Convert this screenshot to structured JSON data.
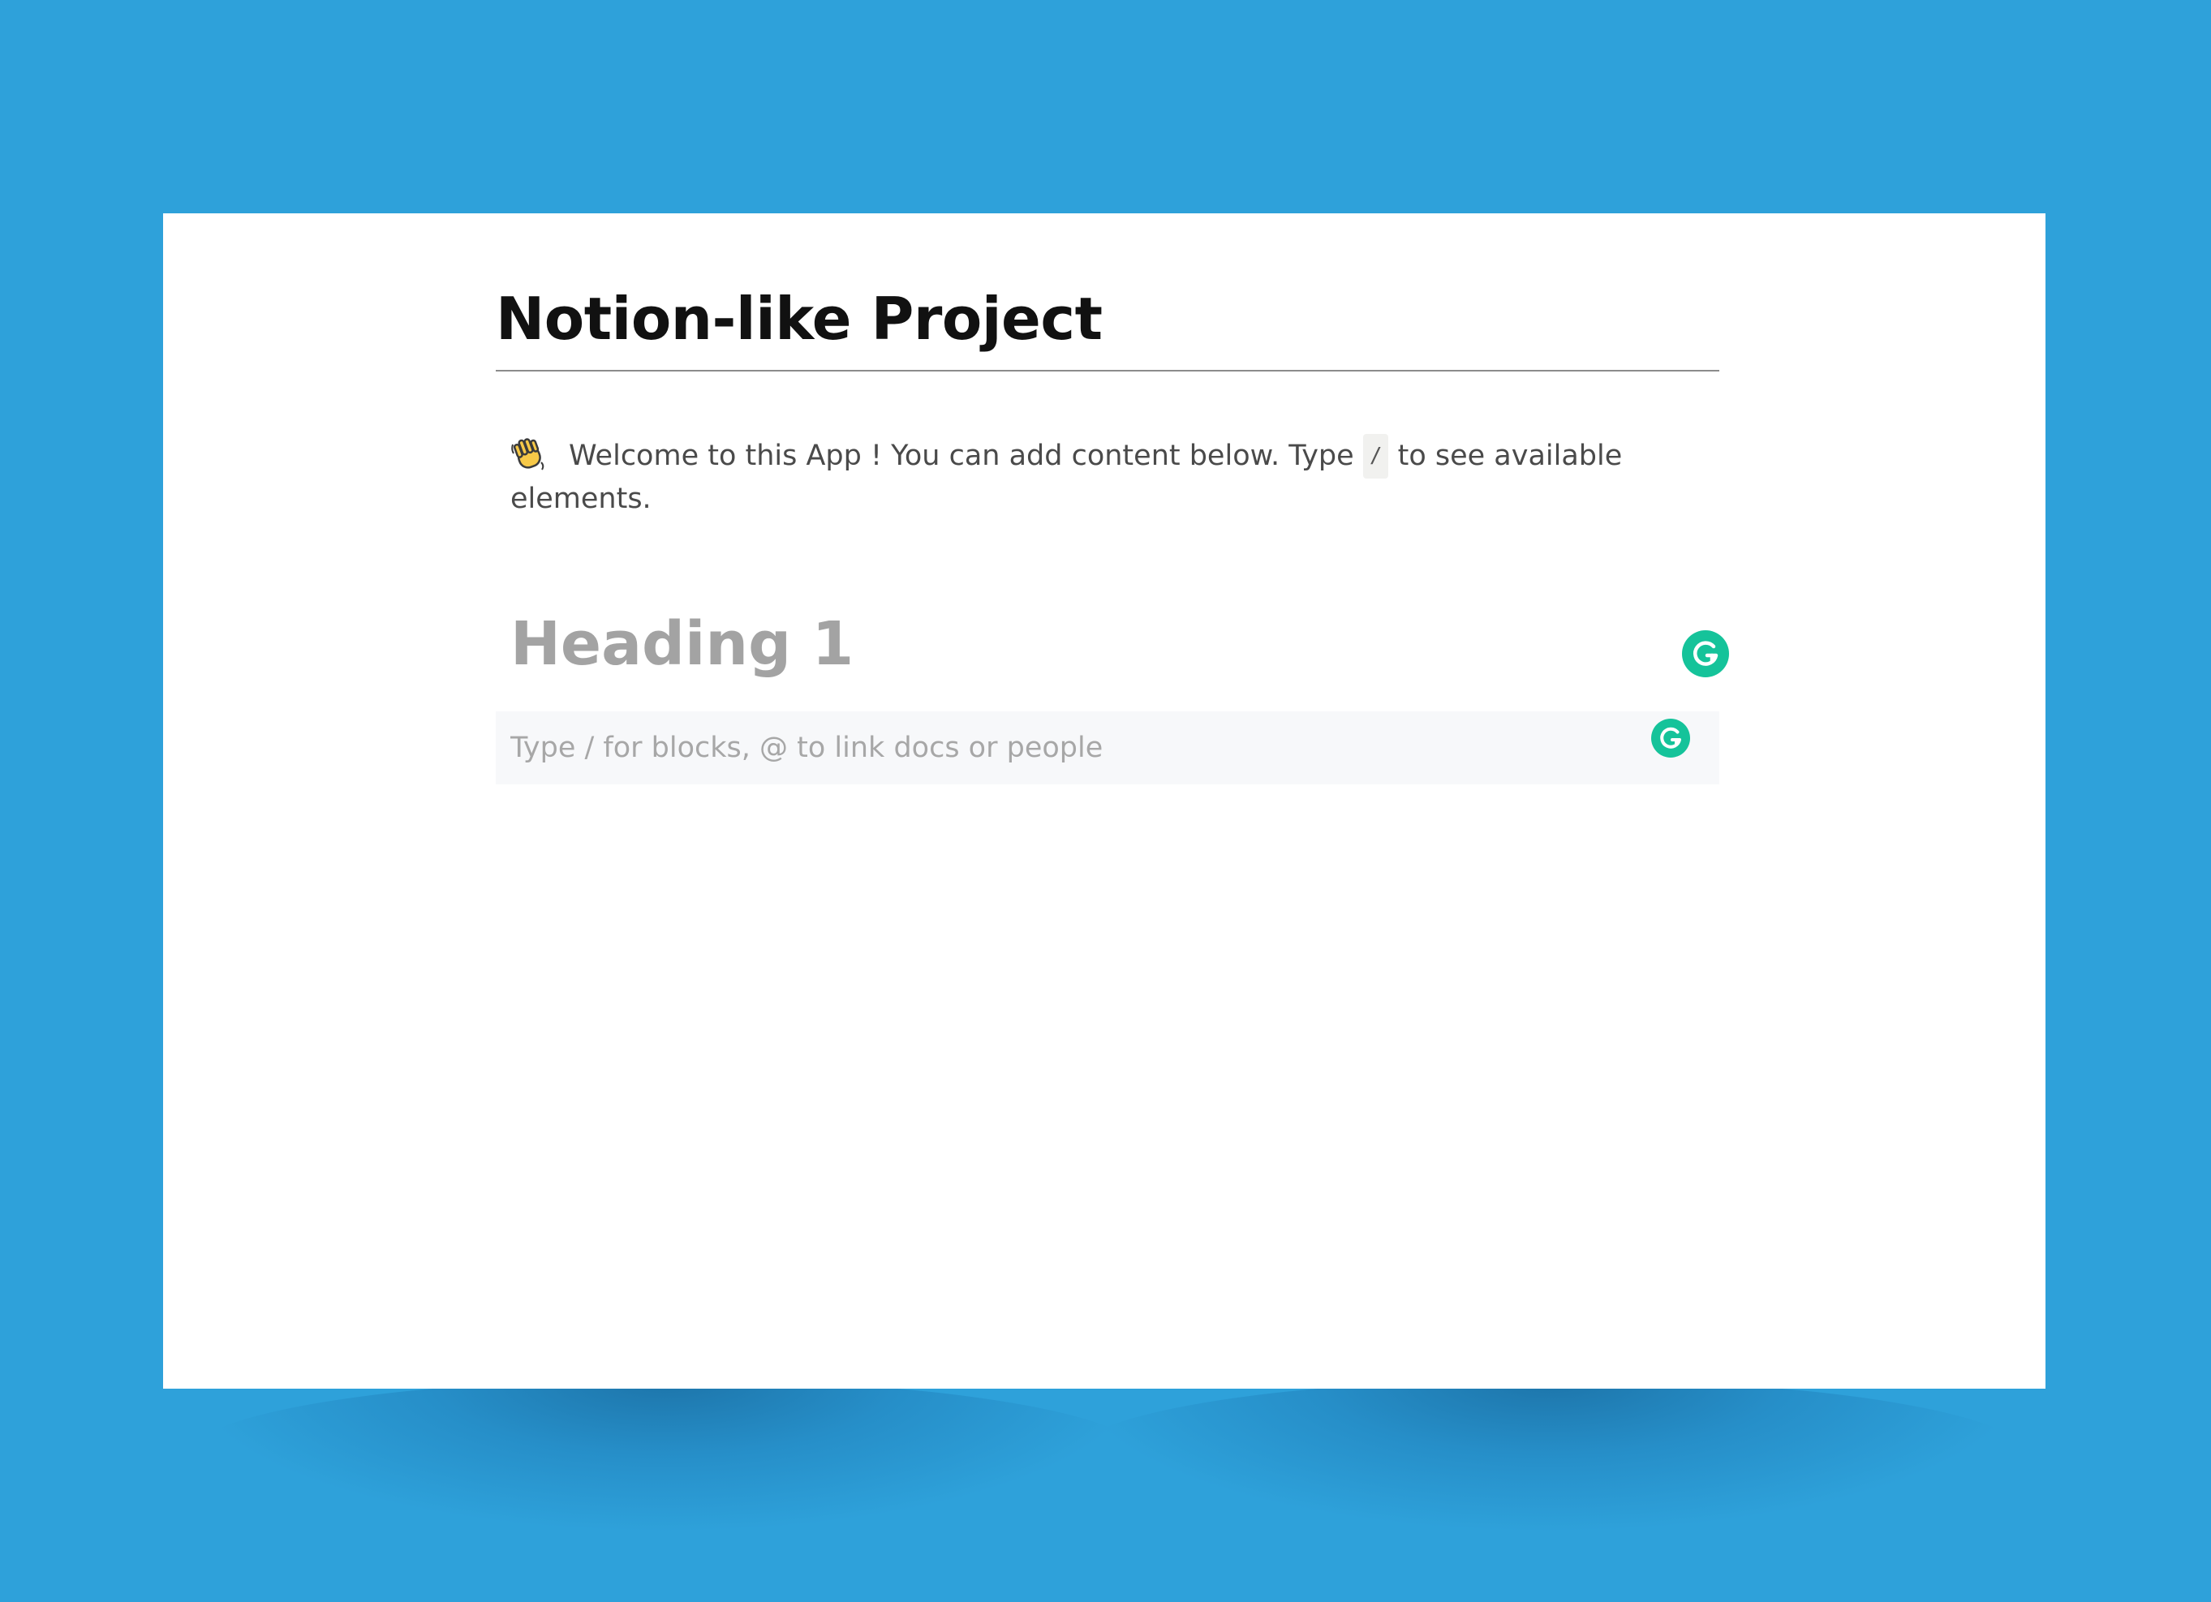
{
  "page": {
    "title": "Notion-like Project"
  },
  "welcome": {
    "icon": "waving-hand-icon",
    "text_before": "Welcome to this App ! You can add content below. Type",
    "code": "/",
    "text_after": "to see available elements."
  },
  "blocks": {
    "heading_placeholder": "Heading 1",
    "input_placeholder": "Type / for blocks, @ to link docs or people",
    "input_value": ""
  },
  "grammar_icon": "grammarly-g-icon",
  "colors": {
    "background": "#2ea1da",
    "card": "#ffffff",
    "title": "#111111",
    "placeholder": "#a3a3a3",
    "grammarly": "#15c39a",
    "input_bg": "#f7f8fa"
  }
}
